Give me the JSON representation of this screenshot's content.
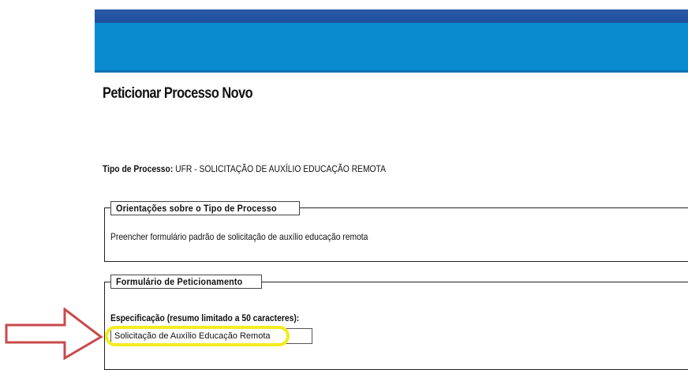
{
  "page": {
    "title": "Peticionar Processo Novo"
  },
  "process_type": {
    "label": "Tipo de Processo:",
    "value": "UFR - SOLICITAÇÃO DE AUXÍLIO EDUCAÇÃO REMOTA"
  },
  "orientation_section": {
    "legend": "Orientações sobre o Tipo de Processo",
    "text": "Preencher formulário padrão de solicitação de auxílio educação remota"
  },
  "form_section": {
    "legend": "Formulário de Peticionamento",
    "spec_label": "Especificação (resumo limitado a 50 caracteres):",
    "spec_value": "Solicitação de Auxílio Educação Remota"
  },
  "annotation": {
    "arrow_color": "#c94a4a",
    "highlight_color": "#f3ec20"
  },
  "colors": {
    "header_blue": "#0a8bd0",
    "header_stripe": "#2a5aa8"
  }
}
